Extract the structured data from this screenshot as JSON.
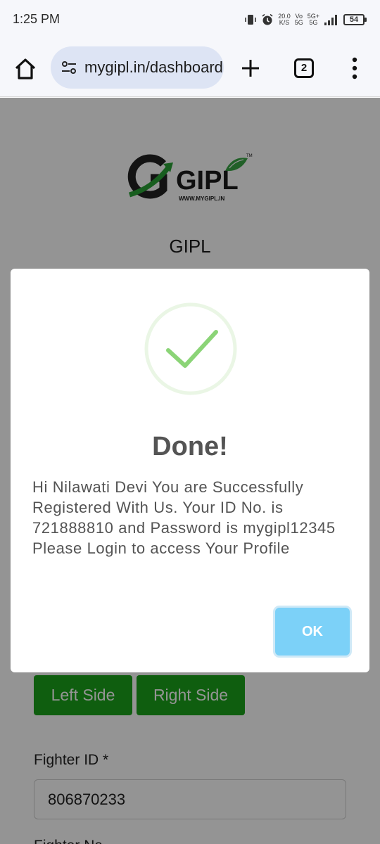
{
  "status_bar": {
    "time": "1:25 PM",
    "speed_value": "20.0",
    "speed_unit": "K/S",
    "vo_label": "Vo",
    "vo_sub": "5G",
    "net_label": "5G+",
    "net_sub": "5G",
    "battery": "54",
    "icons": [
      "vibrate-icon",
      "alarm-icon",
      "signal-icon",
      "battery-icon"
    ]
  },
  "browser": {
    "url": "mygipl.in/dashboard",
    "tab_count": "2",
    "icons": [
      "home-icon",
      "site-settings-icon",
      "new-tab-icon",
      "tabs-icon",
      "more-menu-icon"
    ]
  },
  "page": {
    "logo_text": "GIPL",
    "logo_url_text": "WWW.MYGIPL.IN",
    "logo_tm": "TM",
    "heading": "GIPL",
    "left_side_label": "Left Side",
    "right_side_label": "Right Side",
    "fighter_id_label": "Fighter ID *",
    "fighter_id_value": "806870233",
    "next_label_partial": "Fighter Na..."
  },
  "modal": {
    "title": "Done!",
    "message": "Hi Nilawati Devi You are Successfully Registered With Us. Your ID No. is 721888810 and Password is mygipl12345 Please Login to access Your Profile",
    "ok_label": "OK"
  },
  "colors": {
    "success_green": "#8bd477",
    "button_green": "#1aa31a",
    "ok_blue": "#7cd1f8",
    "url_pill": "#dde4f4"
  }
}
